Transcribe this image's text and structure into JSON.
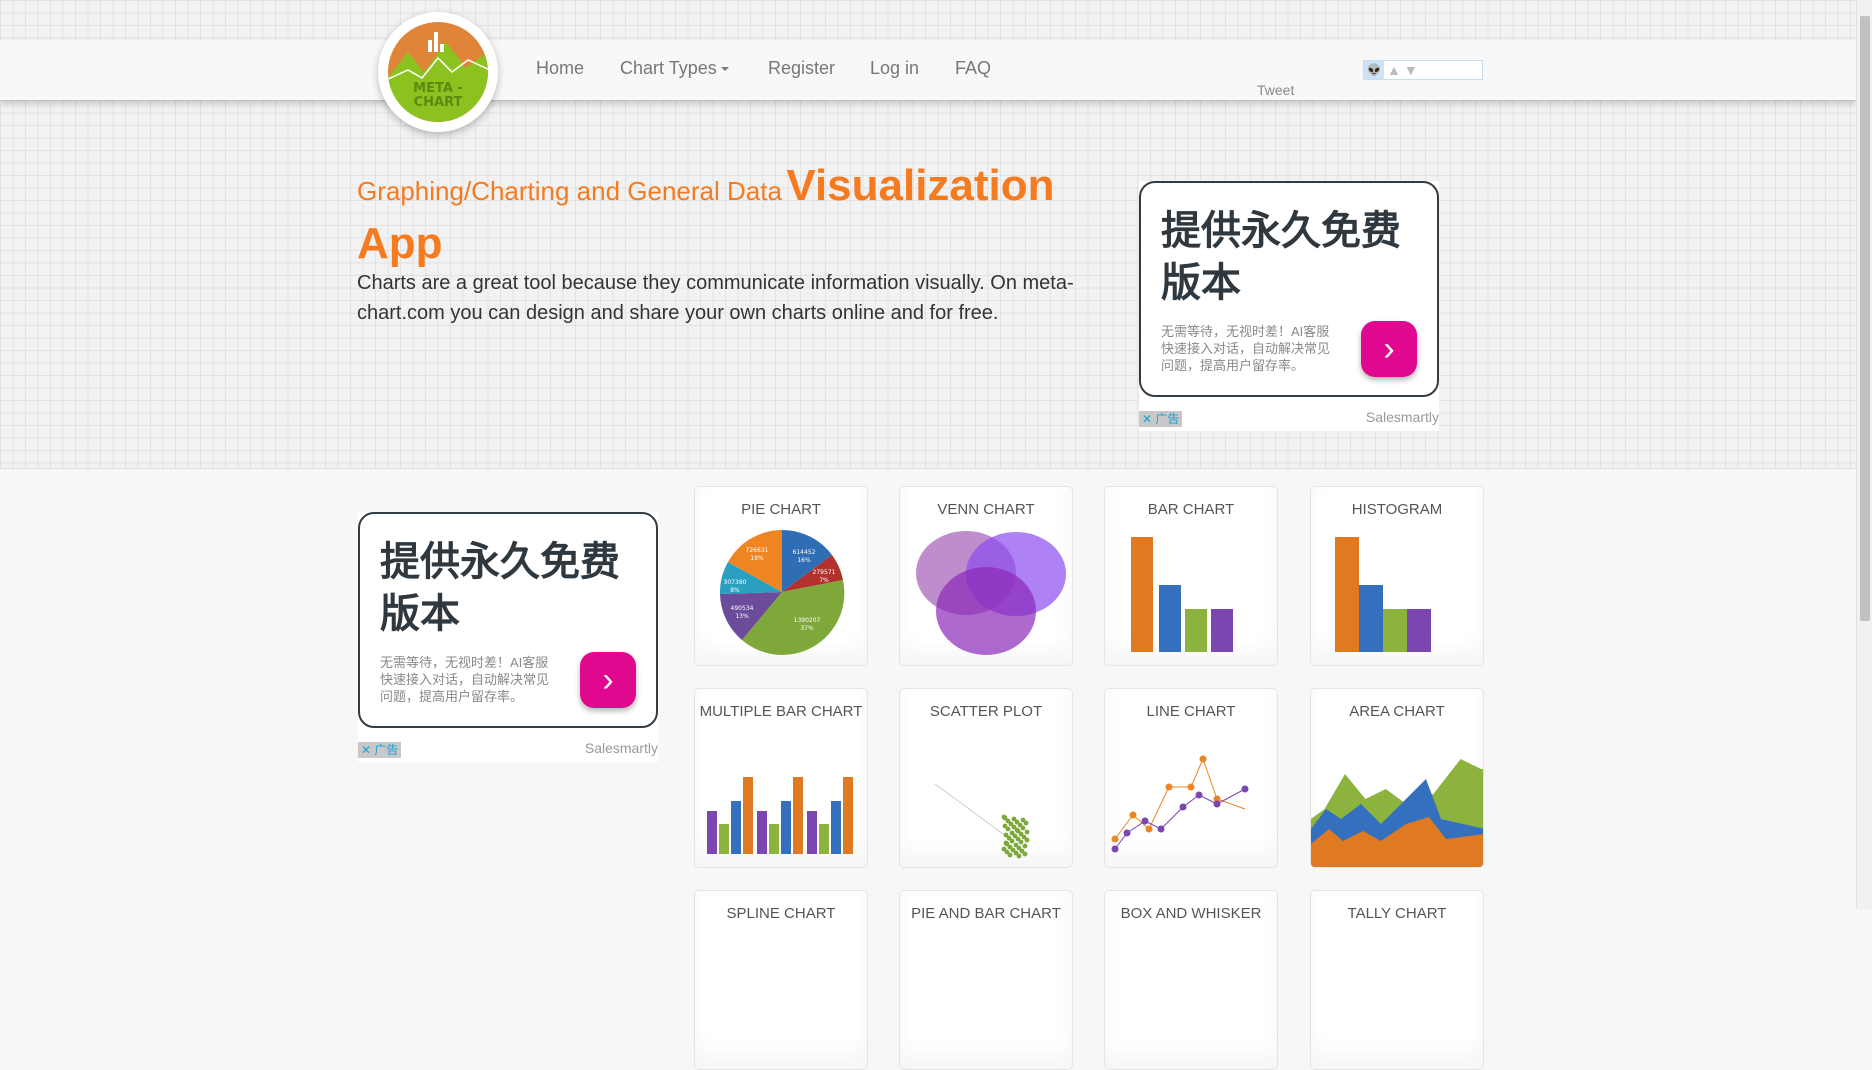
{
  "nav": {
    "items": [
      {
        "label": "Home"
      },
      {
        "label": "Chart Types"
      },
      {
        "label": "Register"
      },
      {
        "label": "Log in"
      },
      {
        "label": "FAQ"
      }
    ],
    "tweet": "Tweet"
  },
  "logo": {
    "text": "META - CHART"
  },
  "hero": {
    "title_small": "Graphing/Charting and General Data",
    "title_big_1": "Visualization",
    "title_big_2": "App",
    "lead": "Charts are a great tool because they communicate information visually. On meta-chart.com you can design and share your own charts online and for free.",
    "accent": "#f47b20"
  },
  "ads": [
    {
      "headline": "提供永久免费版本",
      "desc": "无需等待，无视时差！AI客服快速接入对话，自动解决常见问题，提高用户留存率。",
      "button": "›",
      "adlabel": "✕ 广告",
      "brand": "Salesmartly"
    },
    {
      "headline": "提供永久免费版本",
      "desc": "无需等待，无视时差！AI客服快速接入对话，自动解决常见问题，提高用户留存率。",
      "button": "›",
      "adlabel": "✕ 广告",
      "brand": "Salesmartly"
    }
  ],
  "charts": [
    {
      "label": "PIE CHART",
      "icon": "pie"
    },
    {
      "label": "VENN CHART",
      "icon": "venn"
    },
    {
      "label": "BAR CHART",
      "icon": "bar"
    },
    {
      "label": "HISTOGRAM",
      "icon": "histogram"
    },
    {
      "label": "MULTIPLE BAR CHART",
      "icon": "multibar"
    },
    {
      "label": "SCATTER PLOT",
      "icon": "scatter"
    },
    {
      "label": "LINE CHART",
      "icon": "line"
    },
    {
      "label": "AREA CHART",
      "icon": "area"
    },
    {
      "label": "SPLINE CHART"
    },
    {
      "label": "PIE AND BAR CHART"
    },
    {
      "label": "BOX AND WHISKER"
    },
    {
      "label": "TALLY CHART"
    }
  ],
  "pie_labels": [
    {
      "v": "614452",
      "p": "16%"
    },
    {
      "v": "279571",
      "p": "7%"
    },
    {
      "v": "1390207",
      "p": "37%"
    },
    {
      "v": "490534",
      "p": "13%"
    },
    {
      "v": "307380",
      "p": "8%"
    },
    {
      "v": "726631",
      "p": "19%"
    }
  ]
}
